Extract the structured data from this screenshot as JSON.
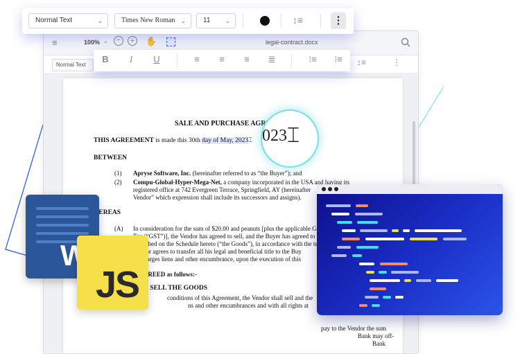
{
  "colors": {
    "accent": "#4f6cf0",
    "glow": "#77e0e3",
    "word_blue": "#2b579a",
    "js_yellow": "#f7df4a",
    "code_bg": "#1b2fc7"
  },
  "format_toolbar": {
    "style_value": "Normal Text",
    "font_value": "Times New Roman",
    "size_value": "11",
    "color_swatch": "#111111",
    "icons": [
      "chevron-down-icon",
      "text-color-icon",
      "line-spacing-icon",
      "more-vertical-icon"
    ]
  },
  "editor": {
    "zoom": "100%",
    "filename": "legal-contract.docx",
    "style_chip": "Normal Text",
    "icons": [
      "menu-icon",
      "zoom-out-icon",
      "zoom-in-icon",
      "pan-hand-icon",
      "select-area-icon",
      "search-icon"
    ]
  },
  "text_toolbar": {
    "buttons": [
      {
        "label": "B",
        "icon": "bold-icon"
      },
      {
        "label": "I",
        "icon": "italic-icon"
      },
      {
        "label": "U",
        "icon": "underline-icon"
      }
    ],
    "icons": [
      "align-left-icon",
      "align-center-icon",
      "align-right-icon",
      "justify-icon",
      "bulleted-list-icon",
      "numbered-list-icon"
    ]
  },
  "document": {
    "title": "SALE AND PURCHASE AGREE",
    "agreement_bold": "THIS AGREEMENT",
    "agreement_text": "is made this 30th",
    "agreement_highlight": "day of May, 2023",
    "between": "BETWEEN",
    "party1_num": "(1)",
    "party1_bold": "Apryse Software, Inc.",
    "party1_rest": "(hereinafter referred to as “the Buyer”); and",
    "party2_num": "(2)",
    "party2_bold": "Compu-Global-Hyper-Mega-Net,",
    "party2_line1": "a company incorporated in the USA and having its",
    "party2_line2": "registered office at 742 Evergreen Terrace, Springfield, AY (hereinafter",
    "party2_line3": "Vendor” which expression shall include its successors and assigns).",
    "whereas": "HEREAS",
    "a_num": "(A)",
    "a_line1": "In consideration for the sum of $20.00 and peanuts [plus the applicable G",
    "a_line2": "Tax (“GST”)], the Vendor has agreed to sell, and the Buyer has agreed to p",
    "a_line3": "described on the Schedule hereto (“the Goods”), in accordance with the te",
    "a_line4": "Vendor agrees to transfer all his legal and beneficial title to the Buy",
    "a_line5": "all charges liens and other encumbrance, upon the execution of this",
    "agreed": "Y AGREED as follows:-",
    "section": "T TO SELL THE GOODS",
    "s_line1": "conditions of this Agreement, the Vendor shall sell and the",
    "s_line2": "ns and other encumbrances and with all rights at",
    "s_line3": "pay to the Vendor the sum",
    "s_line4": "Bank may off-",
    "s_line5": "Bank"
  },
  "magnifier": {
    "text": "023"
  },
  "logos": {
    "word_letter": "W",
    "js_text": "JS"
  }
}
